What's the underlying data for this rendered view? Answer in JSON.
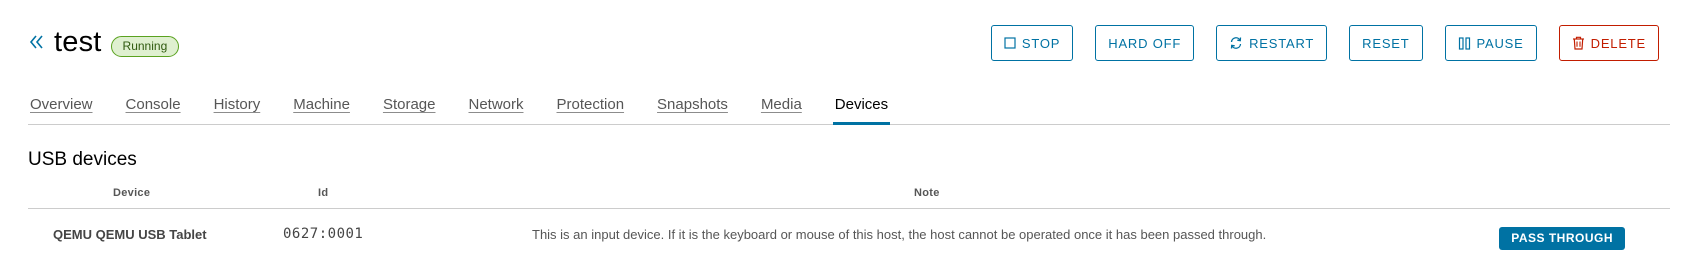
{
  "header": {
    "back_glyph": "«",
    "vm_name": "test",
    "status": "Running",
    "status_color": "#5aa220"
  },
  "actions": {
    "stop": "STOP",
    "hard_off": "HARD OFF",
    "restart": "RESTART",
    "reset": "RESET",
    "pause": "PAUSE",
    "delete": "DELETE",
    "primary_color": "#0072a3",
    "danger_color": "#c21d00"
  },
  "tabs": [
    {
      "label": "Overview"
    },
    {
      "label": "Console"
    },
    {
      "label": "History"
    },
    {
      "label": "Machine"
    },
    {
      "label": "Storage"
    },
    {
      "label": "Network"
    },
    {
      "label": "Protection"
    },
    {
      "label": "Snapshots"
    },
    {
      "label": "Media"
    },
    {
      "label": "Devices",
      "active": true
    }
  ],
  "usb": {
    "title": "USB devices",
    "columns": {
      "device": "Device",
      "id": "Id",
      "note": "Note"
    },
    "rows": [
      {
        "device": "QEMU QEMU USB Tablet",
        "id": "0627:0001",
        "note": "This is an input device. If it is the keyboard or mouse of this host, the host cannot be operated once it has been passed through.",
        "action": "PASS THROUGH"
      }
    ]
  }
}
